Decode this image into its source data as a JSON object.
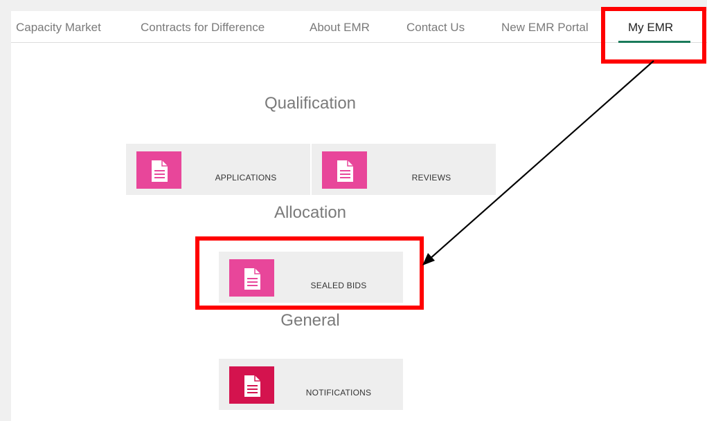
{
  "nav": {
    "items": [
      {
        "label": "Capacity Market"
      },
      {
        "label": "Contracts for Difference"
      },
      {
        "label": "About EMR"
      },
      {
        "label": "Contact Us"
      },
      {
        "label": "New EMR Portal"
      },
      {
        "label": "My EMR",
        "active": true
      }
    ]
  },
  "sections": [
    {
      "title": "Qualification",
      "tiles": [
        {
          "label": "APPLICATIONS",
          "icon": "document-icon",
          "color": "#e8469a"
        },
        {
          "label": "REVIEWS",
          "icon": "document-icon",
          "color": "#e8469a"
        }
      ]
    },
    {
      "title": "Allocation",
      "tiles": [
        {
          "label": "SEALED BIDS",
          "icon": "document-icon",
          "color": "#e8469a"
        }
      ]
    },
    {
      "title": "General",
      "tiles": [
        {
          "label": "NOTIFICATIONS",
          "icon": "document-icon",
          "color": "#d4134e"
        }
      ]
    }
  ],
  "colors": {
    "accent_underline": "#1a7a5a",
    "annotation": "#ff0000",
    "tile_background": "#eeeeee"
  }
}
